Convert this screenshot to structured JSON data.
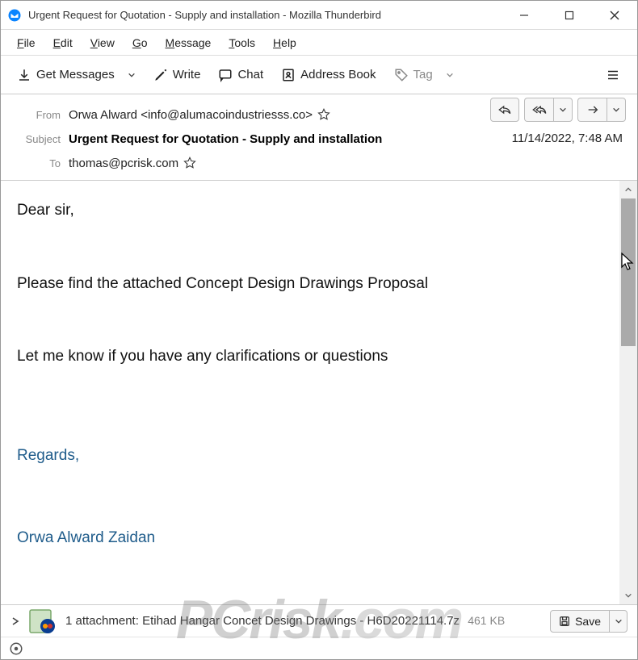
{
  "window": {
    "title": "Urgent Request for Quotation - Supply and installation - Mozilla Thunderbird"
  },
  "menu": {
    "items": [
      "File",
      "Edit",
      "View",
      "Go",
      "Message",
      "Tools",
      "Help"
    ]
  },
  "toolbar": {
    "get_messages": "Get Messages",
    "write": "Write",
    "chat": "Chat",
    "address_book": "Address Book",
    "tag": "Tag"
  },
  "headers": {
    "from_label": "From",
    "from_value": "Orwa Alward <info@alumacoindustriesss.co>",
    "subject_label": "Subject",
    "subject_value": "Urgent Request for Quotation - Supply and installation",
    "to_label": "To",
    "to_value": "thomas@pcrisk.com",
    "date": "11/14/2022, 7:48 AM"
  },
  "body": {
    "p1": "Dear sir,",
    "p2": "Please find the attached Concept Design Drawings  Proposal",
    "p3": "Let me know if you have any clarifications or questions",
    "sig1": "Regards,",
    "sig2": "Orwa Alward Zaidan"
  },
  "attachment": {
    "prefix": "1 attachment:",
    "filename": "Etihad Hangar Concet Design Drawings - H6D20221114.7z",
    "size": "461 KB",
    "save": "Save"
  },
  "watermark": "PCrisk.com"
}
